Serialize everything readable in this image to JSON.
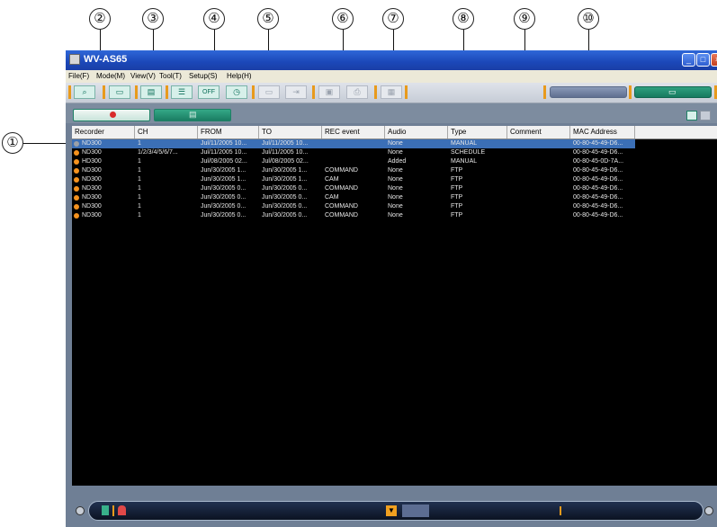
{
  "callouts": [
    "②",
    "③",
    "④",
    "⑤",
    "⑥",
    "⑦",
    "⑧",
    "⑨",
    "⑩",
    "①"
  ],
  "window": {
    "title": "WV-AS65"
  },
  "menu": [
    "File(F)",
    "Mode(M)",
    "View(V)",
    "Tool(T)",
    "Setup(S)",
    "Help(H)"
  ],
  "toolbar": {
    "off_label": "OFF"
  },
  "columns": [
    "Recorder",
    "CH",
    "FROM",
    "TO",
    "REC event",
    "Audio",
    "Type",
    "Comment",
    "MAC Address"
  ],
  "rows": [
    {
      "recorder": "ND300",
      "ch": "1",
      "from": "Jul/11/2005 10...",
      "to": "Jul/11/2005 10...",
      "event": "",
      "audio": "None",
      "type": "MANUAL",
      "comment": "",
      "mac": "00-80-45-49-D6..."
    },
    {
      "recorder": "ND300",
      "ch": "1/2/3/4/5/6/7...",
      "from": "Jul/11/2005 10...",
      "to": "Jul/11/2005 10...",
      "event": "",
      "audio": "None",
      "type": "SCHEDULE",
      "comment": "",
      "mac": "00-80-45-49-D6..."
    },
    {
      "recorder": "HD300",
      "ch": "1",
      "from": "Jul/08/2005 02...",
      "to": "Jul/08/2005 02...",
      "event": "",
      "audio": "Added",
      "type": "MANUAL",
      "comment": "",
      "mac": "00-80-45-0D-7A..."
    },
    {
      "recorder": "ND300",
      "ch": "1",
      "from": "Jun/30/2005 1...",
      "to": "Jun/30/2005 1...",
      "event": "COMMAND",
      "audio": "None",
      "type": "FTP",
      "comment": "",
      "mac": "00-80-45-49-D6..."
    },
    {
      "recorder": "ND300",
      "ch": "1",
      "from": "Jun/30/2005 1...",
      "to": "Jun/30/2005 1...",
      "event": "CAM",
      "audio": "None",
      "type": "FTP",
      "comment": "",
      "mac": "00-80-45-49-D6..."
    },
    {
      "recorder": "ND300",
      "ch": "1",
      "from": "Jun/30/2005 0...",
      "to": "Jun/30/2005 0...",
      "event": "COMMAND",
      "audio": "None",
      "type": "FTP",
      "comment": "",
      "mac": "00-80-45-49-D6..."
    },
    {
      "recorder": "ND300",
      "ch": "1",
      "from": "Jun/30/2005 0...",
      "to": "Jun/30/2005 0...",
      "event": "CAM",
      "audio": "None",
      "type": "FTP",
      "comment": "",
      "mac": "00-80-45-49-D6..."
    },
    {
      "recorder": "ND300",
      "ch": "1",
      "from": "Jun/30/2005 0...",
      "to": "Jun/30/2005 0...",
      "event": "COMMAND",
      "audio": "None",
      "type": "FTP",
      "comment": "",
      "mac": "00-80-45-49-D6..."
    },
    {
      "recorder": "ND300",
      "ch": "1",
      "from": "Jun/30/2005 0...",
      "to": "Jun/30/2005 0...",
      "event": "COMMAND",
      "audio": "None",
      "type": "FTP",
      "comment": "",
      "mac": "00-80-45-49-D6..."
    }
  ],
  "colors": {
    "selection": "#3b6fb6",
    "accent": "#f5921e",
    "teal": "#1f8066"
  }
}
